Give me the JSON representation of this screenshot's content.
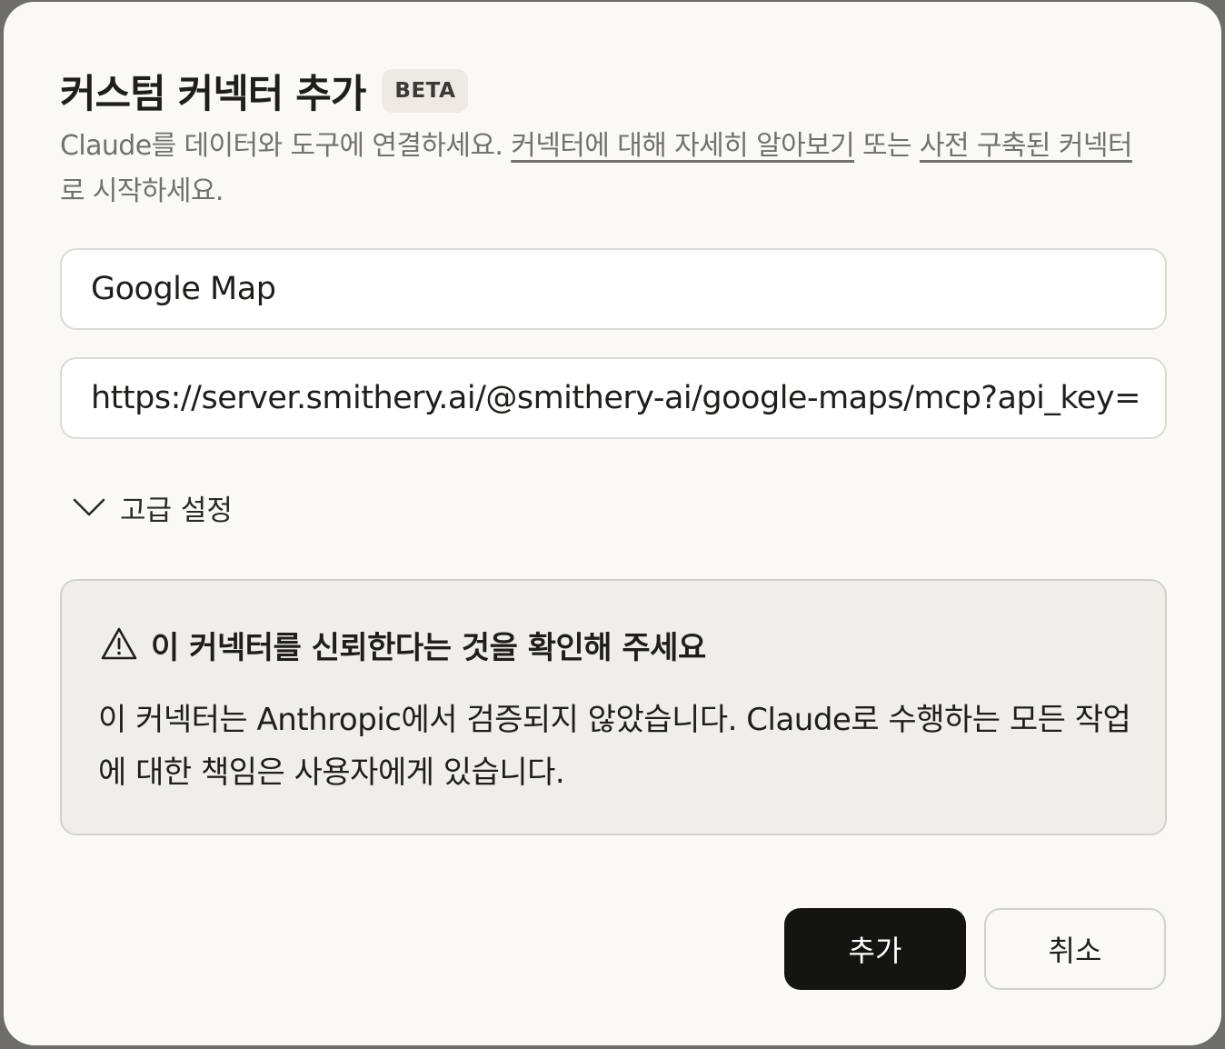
{
  "dialog": {
    "title": "커스텀 커넥터 추가",
    "badge": "BETA",
    "description": {
      "prefix": "Claude를 데이터와 도구에 연결하세요. ",
      "link1": "커넥터에 대해 자세히 알아보기",
      "middle": " 또는 ",
      "link2": "사전 구축된 커넥터",
      "suffix": "로 시작하세요."
    },
    "name_input": {
      "value": "Google Map"
    },
    "url_input": {
      "value": "https://server.smithery.ai/@smithery-ai/google-maps/mcp?api_key=..."
    },
    "advanced_settings_label": "고급 설정",
    "warning": {
      "icon": "warning-triangle-icon",
      "title": "이 커넥터를 신뢰한다는 것을 확인해 주세요",
      "body": "이 커넥터는 Anthropic에서 검증되지 않았습니다. Claude로 수행하는 모든 작업에 대한 책임은 사용자에게 있습니다."
    },
    "buttons": {
      "add_label": "추가",
      "cancel_label": "취소"
    }
  }
}
